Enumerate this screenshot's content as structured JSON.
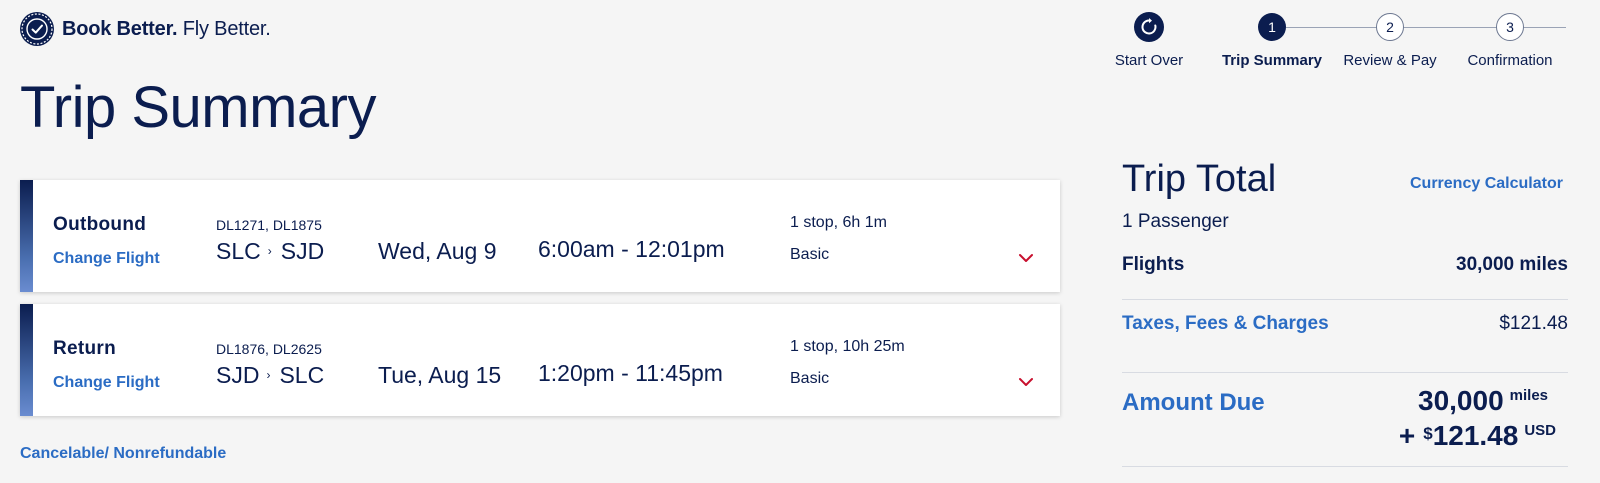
{
  "logo": {
    "bold_text": "Book Better.",
    "normal_text": " Fly Better."
  },
  "stepper": {
    "start_over": "Start Over",
    "steps": [
      {
        "num": "1",
        "label": "Trip Summary",
        "active": true
      },
      {
        "num": "2",
        "label": "Review & Pay",
        "active": false
      },
      {
        "num": "3",
        "label": "Confirmation",
        "active": false
      }
    ]
  },
  "page_title": "Trip Summary",
  "flights": [
    {
      "direction": "Outbound",
      "change_label": "Change Flight",
      "flight_numbers": "DL1271, DL1875",
      "origin": "SLC",
      "destination": "SJD",
      "date": "Wed, Aug 9",
      "times": "6:00am - 12:01pm",
      "stops": "1 stop, 6h 1m",
      "fare": "Basic"
    },
    {
      "direction": "Return",
      "change_label": "Change Flight",
      "flight_numbers": "DL1876, DL2625",
      "origin": "SJD",
      "destination": "SLC",
      "date": "Tue, Aug 15",
      "times": "1:20pm - 11:45pm",
      "stops": "1 stop, 10h 25m",
      "fare": "Basic"
    }
  ],
  "cancel_note": "Cancelable/ Nonrefundable",
  "trip_total": {
    "title": "Trip Total",
    "currency_calculator": "Currency Calculator",
    "passengers": "1 Passenger",
    "flights_label": "Flights",
    "flights_value": "30,000 miles",
    "taxes_label": "Taxes, Fees & Charges",
    "taxes_value": "$121.48",
    "amount_due_label": "Amount Due",
    "due_miles_value": "30,000",
    "due_miles_unit": "miles",
    "due_plus": "+",
    "due_currency_symbol": "$",
    "due_usd_value": "121.48",
    "due_usd_unit": "USD"
  },
  "colors": {
    "navy": "#0b1d4f",
    "link_blue": "#2b6cc4",
    "chevron_red": "#c8102e",
    "background": "#f5f5f5"
  }
}
